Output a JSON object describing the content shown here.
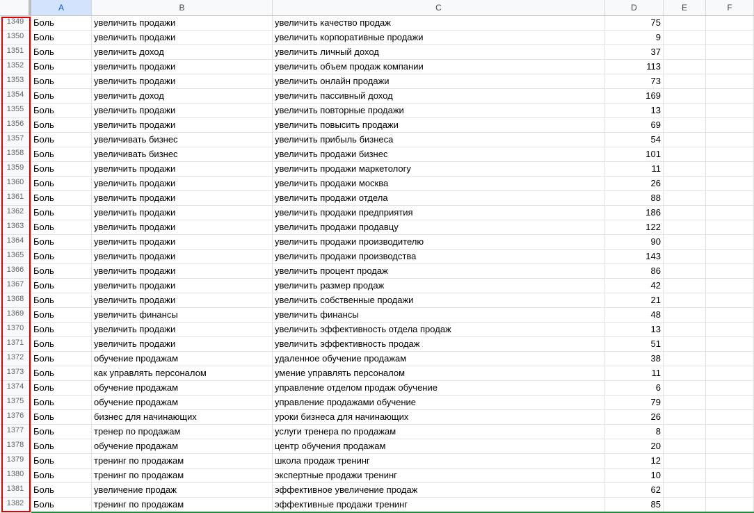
{
  "columns": [
    "A",
    "B",
    "C",
    "D",
    "E",
    "F"
  ],
  "rows": [
    {
      "n": "1349",
      "a": "Боль",
      "b": "увеличить продажи",
      "c": "увеличить качество продаж",
      "d": "75"
    },
    {
      "n": "1350",
      "a": "Боль",
      "b": "увеличить продажи",
      "c": "увеличить корпоративные продажи",
      "d": "9"
    },
    {
      "n": "1351",
      "a": "Боль",
      "b": "увеличить доход",
      "c": "увеличить личный доход",
      "d": "37"
    },
    {
      "n": "1352",
      "a": "Боль",
      "b": "увеличить продажи",
      "c": "увеличить объем продаж компании",
      "d": "113"
    },
    {
      "n": "1353",
      "a": "Боль",
      "b": "увеличить продажи",
      "c": "увеличить онлайн продажи",
      "d": "73"
    },
    {
      "n": "1354",
      "a": "Боль",
      "b": "увеличить доход",
      "c": "увеличить пассивный доход",
      "d": "169"
    },
    {
      "n": "1355",
      "a": "Боль",
      "b": "увеличить продажи",
      "c": "увеличить повторные продажи",
      "d": "13"
    },
    {
      "n": "1356",
      "a": "Боль",
      "b": "увеличить продажи",
      "c": "увеличить повысить продажи",
      "d": "69"
    },
    {
      "n": "1357",
      "a": "Боль",
      "b": "увеличивать бизнес",
      "c": "увеличить прибыль бизнеса",
      "d": "54"
    },
    {
      "n": "1358",
      "a": "Боль",
      "b": "увеличивать бизнес",
      "c": "увеличить продажи бизнес",
      "d": "101"
    },
    {
      "n": "1359",
      "a": "Боль",
      "b": "увеличить продажи",
      "c": "увеличить продажи маркетологу",
      "d": "11"
    },
    {
      "n": "1360",
      "a": "Боль",
      "b": "увеличить продажи",
      "c": "увеличить продажи москва",
      "d": "26"
    },
    {
      "n": "1361",
      "a": "Боль",
      "b": "увеличить продажи",
      "c": "увеличить продажи отдела",
      "d": "88"
    },
    {
      "n": "1362",
      "a": "Боль",
      "b": "увеличить продажи",
      "c": "увеличить продажи предприятия",
      "d": "186"
    },
    {
      "n": "1363",
      "a": "Боль",
      "b": "увеличить продажи",
      "c": "увеличить продажи продавцу",
      "d": "122"
    },
    {
      "n": "1364",
      "a": "Боль",
      "b": "увеличить продажи",
      "c": "увеличить продажи производителю",
      "d": "90"
    },
    {
      "n": "1365",
      "a": "Боль",
      "b": "увеличить продажи",
      "c": "увеличить продажи производства",
      "d": "143"
    },
    {
      "n": "1366",
      "a": "Боль",
      "b": "увеличить продажи",
      "c": "увеличить процент продаж",
      "d": "86"
    },
    {
      "n": "1367",
      "a": "Боль",
      "b": "увеличить продажи",
      "c": "увеличить размер продаж",
      "d": "42"
    },
    {
      "n": "1368",
      "a": "Боль",
      "b": "увеличить продажи",
      "c": "увеличить собственные продажи",
      "d": "21"
    },
    {
      "n": "1369",
      "a": "Боль",
      "b": "увеличить финансы",
      "c": "увеличить финансы",
      "d": "48"
    },
    {
      "n": "1370",
      "a": "Боль",
      "b": "увеличить продажи",
      "c": "увеличить эффективность отдела продаж",
      "d": "13"
    },
    {
      "n": "1371",
      "a": "Боль",
      "b": "увеличить продажи",
      "c": "увеличить эффективность продаж",
      "d": "51"
    },
    {
      "n": "1372",
      "a": "Боль",
      "b": "обучение продажам",
      "c": "удаленное обучение продажам",
      "d": "38"
    },
    {
      "n": "1373",
      "a": "Боль",
      "b": "как управлять персоналом",
      "c": "умение управлять персоналом",
      "d": "11"
    },
    {
      "n": "1374",
      "a": "Боль",
      "b": "обучение продажам",
      "c": "управление отделом продаж обучение",
      "d": "6"
    },
    {
      "n": "1375",
      "a": "Боль",
      "b": "обучение продажам",
      "c": "управление продажами обучение",
      "d": "79"
    },
    {
      "n": "1376",
      "a": "Боль",
      "b": "бизнес для начинающих",
      "c": "уроки бизнеса для начинающих",
      "d": "26"
    },
    {
      "n": "1377",
      "a": "Боль",
      "b": "тренер по продажам",
      "c": "услуги тренера по продажам",
      "d": "8"
    },
    {
      "n": "1378",
      "a": "Боль",
      "b": "обучение продажам",
      "c": "центр обучения продажам",
      "d": "20"
    },
    {
      "n": "1379",
      "a": "Боль",
      "b": "тренинг по продажам",
      "c": "школа продаж тренинг",
      "d": "12"
    },
    {
      "n": "1380",
      "a": "Боль",
      "b": "тренинг по продажам",
      "c": "экспертные продажи тренинг",
      "d": "10"
    },
    {
      "n": "1381",
      "a": "Боль",
      "b": "увеличение продаж",
      "c": "эффективное увеличение продаж",
      "d": "62"
    },
    {
      "n": "1382",
      "a": "Боль",
      "b": "тренинг по продажам",
      "c": "эффективные продажи тренинг",
      "d": "85"
    }
  ],
  "colors": {
    "selection_outline": "#e00000",
    "selected_header": "#d3e3fd",
    "header_bg": "#f8f9fa"
  }
}
